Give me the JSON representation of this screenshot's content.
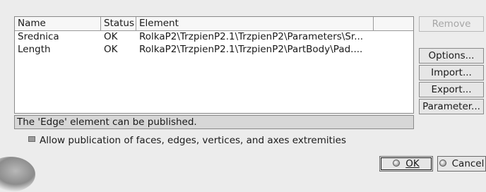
{
  "table": {
    "headers": {
      "name": "Name",
      "status": "Status",
      "element": "Element",
      "extra": ""
    },
    "rows": [
      {
        "name": "Srednica",
        "status": "OK",
        "element": "RolkaP2\\TrzpienP2.1\\TrzpienP2\\Parameters\\Sr..."
      },
      {
        "name": "Length",
        "status": "OK",
        "element": "RolkaP2\\TrzpienP2.1\\TrzpienP2\\PartBody\\Pad...."
      }
    ]
  },
  "status_message": "The 'Edge' element can be published.",
  "checkbox": {
    "label": "Allow publication of faces, edges, vertices, and axes extremities",
    "checked": true
  },
  "side_buttons": {
    "remove": "Remove",
    "options": "Options...",
    "import": "Import...",
    "export": "Export...",
    "parameter": "Parameter..."
  },
  "dialog_buttons": {
    "ok": "OK",
    "cancel": "Cancel"
  }
}
